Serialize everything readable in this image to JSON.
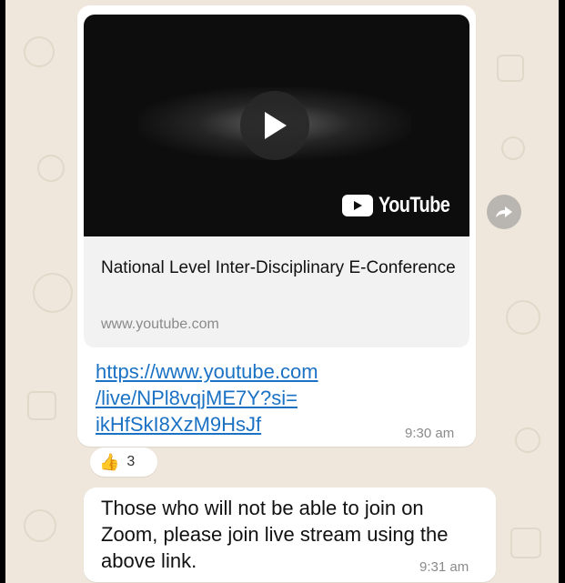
{
  "video": {
    "logo_text": "YouTube",
    "title": "National Level Inter-Disciplinary E-Conference",
    "domain": "www.youtube.com",
    "link_line1": "https://www.youtube.com",
    "link_line2": "/live/NPl8vqjME7Y?si=",
    "link_line3": "ikHfSkI8XzM9HsJf",
    "time": "9:30 am"
  },
  "reaction": {
    "emoji": "👍",
    "count": "3"
  },
  "message2": {
    "text": "Those who will not be able to join on Zoom, please join live stream using the above link.",
    "time": "9:31 am"
  },
  "colors": {
    "chat_background": "#efe7dc",
    "link": "#1b72c4",
    "bubble": "#ffffff"
  },
  "icons": [
    "play-icon",
    "youtube-logo-icon",
    "forward-icon",
    "thumbs-up-icon"
  ]
}
